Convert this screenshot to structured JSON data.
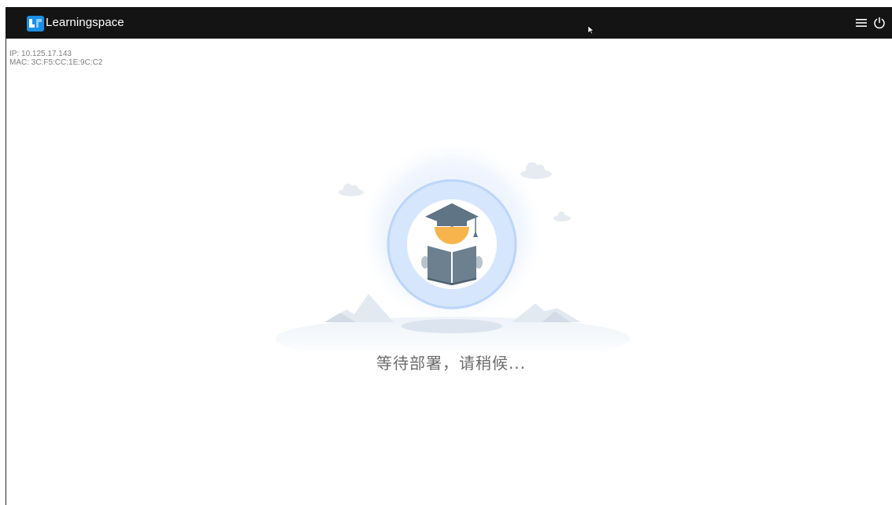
{
  "header": {
    "brand_name": "Learningspace",
    "logo_icon": "learningspace-logo-icon",
    "menu_icon": "hamburger-menu-icon",
    "power_icon": "power-icon",
    "background_color": "#141414"
  },
  "device_info": {
    "ip_line": "IP: 10.125.17.143",
    "mac_line": "MAC: 3C:F5:CC:1E:9C:C2"
  },
  "main": {
    "illustration": "graduate-reading-book-illustration",
    "status_message": "等待部署，请稍候..."
  },
  "colors": {
    "accent_blue": "#1a8fe8",
    "circle_blue": "#cfe1fb",
    "text_gray": "#6b6b6b"
  }
}
